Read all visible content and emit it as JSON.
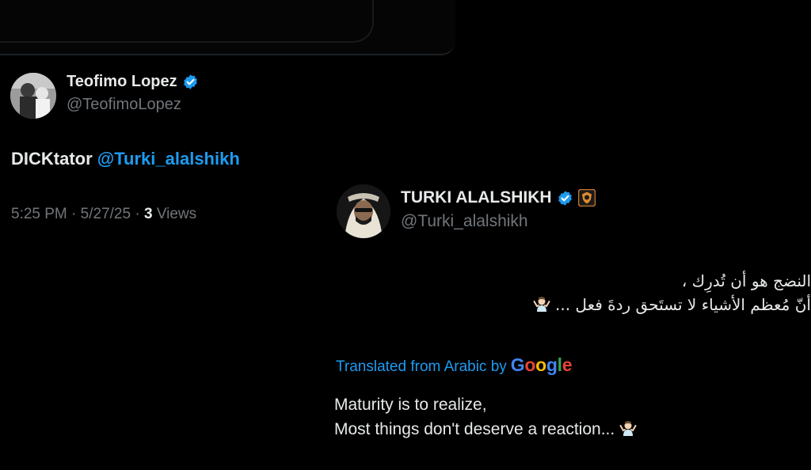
{
  "tweet1": {
    "display_name": "Teofimo Lopez",
    "handle": "@TeofimoLopez",
    "body_text": "DICKtator ",
    "mention": "@Turki_alalshikh",
    "time": "5:25 PM",
    "date": "5/27/25",
    "views_count": "3",
    "views_label": "Views",
    "separator": "·"
  },
  "tweet2": {
    "display_name": "TURKI ALALSHIKH",
    "handle": "@Turki_alalshikh",
    "arabic_line1": "النضج هو أن تُدرِك ،",
    "arabic_line2": "أنّ مُعظم الأشياء لا تستَحق ردةَ فعل ...",
    "translated_label": "Translated from Arabic by",
    "google_g1": "G",
    "google_o1": "o",
    "google_o2": "o",
    "google_g2": "g",
    "google_l": "l",
    "google_e": "e",
    "translation_line1": "Maturity is to realize,",
    "translation_line2": "Most things don't deserve a reaction..."
  },
  "icons": {
    "verified": "verified-icon",
    "crest": "crest-icon",
    "shrug": "person-shrugging-icon"
  },
  "colors": {
    "background": "#000000",
    "text": "#e7e9ea",
    "muted": "#71767b",
    "link": "#1d9bf0"
  }
}
